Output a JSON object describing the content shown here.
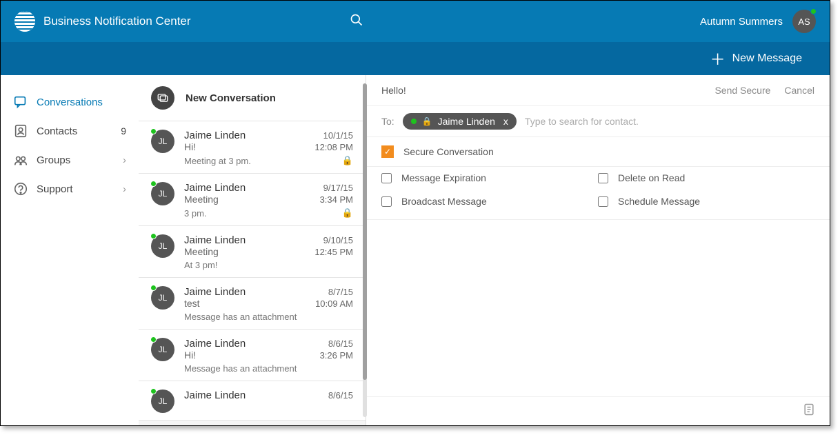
{
  "header": {
    "app_title": "Business Notification Center",
    "user_name": "Autumn Summers",
    "user_initials": "AS",
    "new_message_label": "New Message"
  },
  "sidebar": {
    "items": [
      {
        "label": "Conversations",
        "active": true
      },
      {
        "label": "Contacts",
        "count": "9"
      },
      {
        "label": "Groups",
        "chevron": true
      },
      {
        "label": "Support",
        "chevron": true
      }
    ]
  },
  "convo_list": {
    "header": "New Conversation",
    "items": [
      {
        "initials": "JL",
        "name": "Jaime Linden",
        "subject": "Hi!",
        "snippet": "Meeting at 3 pm.",
        "date": "10/1/15",
        "time": "12:08 PM",
        "secure": true
      },
      {
        "initials": "JL",
        "name": "Jaime Linden",
        "subject": "Meeting",
        "snippet": "3 pm.",
        "date": "9/17/15",
        "time": "3:34 PM",
        "secure": true
      },
      {
        "initials": "JL",
        "name": "Jaime Linden",
        "subject": "Meeting",
        "snippet": "At 3 pm!",
        "date": "9/10/15",
        "time": "12:45 PM",
        "secure": false
      },
      {
        "initials": "JL",
        "name": "Jaime Linden",
        "subject": "test",
        "snippet": "Message has an attachment",
        "date": "8/7/15",
        "time": "10:09 AM",
        "secure": false
      },
      {
        "initials": "JL",
        "name": "Jaime Linden",
        "subject": "Hi!",
        "snippet": "Message has an attachment",
        "date": "8/6/15",
        "time": "3:26 PM",
        "secure": false
      },
      {
        "initials": "JL",
        "name": "Jaime Linden",
        "subject": "",
        "snippet": "",
        "date": "8/6/15",
        "time": "",
        "secure": false
      }
    ]
  },
  "compose": {
    "subject_value": "Hello!",
    "send_secure": "Send Secure",
    "cancel": "Cancel",
    "to_label": "To:",
    "recipient_name": "Jaime Linden",
    "to_placeholder": "Type to search for contact.",
    "secure_label": "Secure Conversation",
    "options": {
      "message_expiration": "Message Expiration",
      "delete_on_read": "Delete on Read",
      "broadcast_message": "Broadcast Message",
      "schedule_message": "Schedule Message"
    }
  }
}
